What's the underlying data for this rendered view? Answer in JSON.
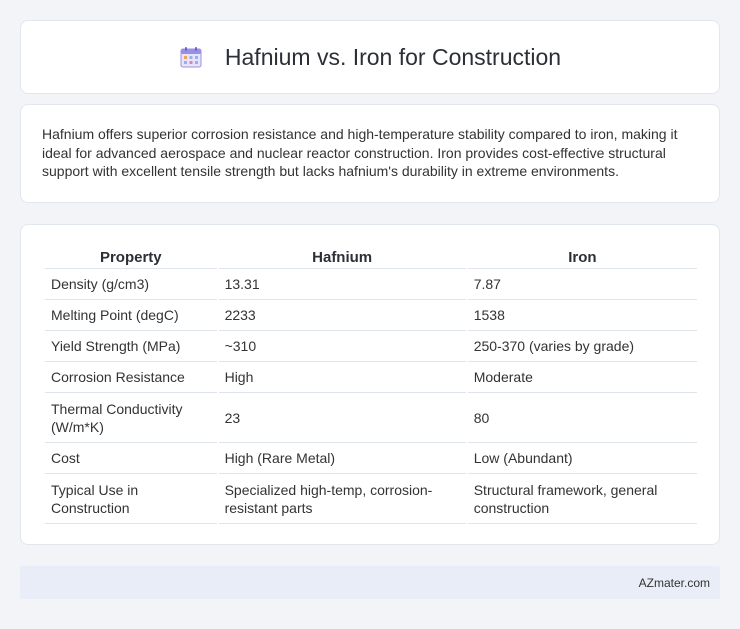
{
  "header": {
    "title": "Hafnium vs. Iron for Construction",
    "icon": "calendar-icon"
  },
  "summary": {
    "text": "Hafnium offers superior corrosion resistance and high-temperature stability compared to iron, making it ideal for advanced aerospace and nuclear reactor construction. Iron provides cost-effective structural support with excellent tensile strength but lacks hafnium's durability in extreme environments."
  },
  "table": {
    "headers": [
      "Property",
      "Hafnium",
      "Iron"
    ],
    "rows": [
      [
        "Density (g/cm3)",
        "13.31",
        "7.87"
      ],
      [
        "Melting Point (degC)",
        "2233",
        "1538"
      ],
      [
        "Yield Strength (MPa)",
        "~310",
        "250-370 (varies by grade)"
      ],
      [
        "Corrosion Resistance",
        "High",
        "Moderate"
      ],
      [
        "Thermal Conductivity (W/m*K)",
        "23",
        "80"
      ],
      [
        "Cost",
        "High (Rare Metal)",
        "Low (Abundant)"
      ],
      [
        "Typical Use in Construction",
        "Specialized high-temp, corrosion-resistant parts",
        "Structural framework, general construction"
      ]
    ]
  },
  "footer": {
    "text": "AZmater.com"
  },
  "colors": {
    "background": "#f2f4f8",
    "card": "#ffffff",
    "footer": "#e8edf7",
    "icon_accent": "#8a7be0"
  }
}
